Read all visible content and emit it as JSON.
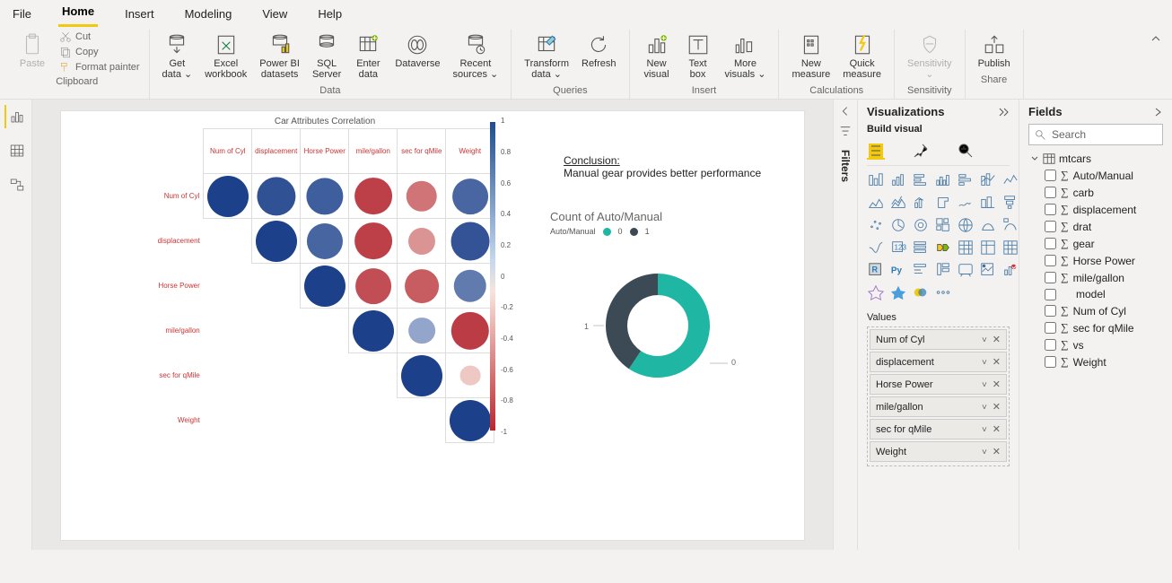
{
  "menu": {
    "items": [
      "File",
      "Home",
      "Insert",
      "Modeling",
      "View",
      "Help"
    ],
    "active": 1
  },
  "ribbon": {
    "groups": [
      {
        "label": "Clipboard"
      },
      {
        "label": "Data"
      },
      {
        "label": "Queries"
      },
      {
        "label": "Insert"
      },
      {
        "label": "Calculations"
      },
      {
        "label": "Sensitivity"
      },
      {
        "label": "Share"
      }
    ],
    "clipboard": {
      "paste": "Paste",
      "cut": "Cut",
      "copy": "Copy",
      "fmt": "Format painter"
    },
    "data": [
      [
        "Get",
        "data ⌄"
      ],
      [
        "Excel",
        "workbook"
      ],
      [
        "Power BI",
        "datasets"
      ],
      [
        "SQL",
        "Server"
      ],
      [
        "Enter",
        "data"
      ],
      [
        "Dataverse",
        ""
      ],
      [
        "Recent",
        "sources ⌄"
      ]
    ],
    "queries": [
      [
        "Transform",
        "data ⌄"
      ],
      [
        "Refresh",
        ""
      ]
    ],
    "insert": [
      [
        "New",
        "visual"
      ],
      [
        "Text",
        "box"
      ],
      [
        "More",
        "visuals ⌄"
      ]
    ],
    "calc": [
      [
        "New",
        "measure"
      ],
      [
        "Quick",
        "measure"
      ]
    ],
    "sens": [
      [
        "Sensitivity",
        "⌄"
      ]
    ],
    "share": [
      [
        "Publish",
        ""
      ]
    ]
  },
  "viz": {
    "title": "Visualizations",
    "sub": "Build visual",
    "values_h": "Values",
    "values": [
      "Num of Cyl",
      "displacement",
      "Horse Power",
      "mile/gallon",
      "sec for qMile",
      "Weight"
    ]
  },
  "filters": {
    "title": "Filters"
  },
  "fields": {
    "title": "Fields",
    "search": "Search",
    "table": "mtcars",
    "cols": [
      {
        "name": "Auto/Manual",
        "sigma": true,
        "checked": false
      },
      {
        "name": "carb",
        "sigma": true,
        "checked": false
      },
      {
        "name": "displacement",
        "sigma": true,
        "checked": false
      },
      {
        "name": "drat",
        "sigma": true,
        "checked": false
      },
      {
        "name": "gear",
        "sigma": true,
        "checked": false
      },
      {
        "name": "Horse Power",
        "sigma": true,
        "checked": false
      },
      {
        "name": "mile/gallon",
        "sigma": true,
        "checked": false
      },
      {
        "name": "model",
        "sigma": false,
        "checked": false
      },
      {
        "name": "Num of Cyl",
        "sigma": true,
        "checked": false
      },
      {
        "name": "sec for qMile",
        "sigma": true,
        "checked": false
      },
      {
        "name": "vs",
        "sigma": true,
        "checked": false
      },
      {
        "name": "Weight",
        "sigma": true,
        "checked": false
      }
    ]
  },
  "report": {
    "conclusion": {
      "head": "Conclusion:",
      "body": "Manual gear provides better performance"
    },
    "donut_title": "Count of Auto/Manual",
    "donut_legend": {
      "label": "Auto/Manual",
      "items": [
        {
          "name": "0",
          "color": "#1fb6a3"
        },
        {
          "name": "1",
          "color": "#3b4a54"
        }
      ]
    }
  },
  "chart_data": [
    {
      "type": "heatmap",
      "title": "Car Attributes Correlation",
      "row_labels": [
        "Num of Cyl",
        "displacement",
        "Horse Power",
        "mile/gallon",
        "sec for qMile",
        "Weight"
      ],
      "col_labels": [
        "Num of Cyl",
        "displacement",
        "Horse Power",
        "mile/gallon",
        "sec for qMile",
        "Weight"
      ],
      "matrix": [
        [
          1.0,
          0.9,
          0.83,
          -0.85,
          -0.59,
          0.78
        ],
        [
          null,
          1.0,
          0.79,
          -0.85,
          -0.43,
          0.89
        ],
        [
          null,
          null,
          1.0,
          -0.78,
          -0.71,
          0.66
        ],
        [
          null,
          null,
          null,
          1.0,
          0.42,
          -0.87
        ],
        [
          null,
          null,
          null,
          null,
          1.0,
          -0.17
        ],
        [
          null,
          null,
          null,
          null,
          null,
          1.0
        ]
      ],
      "colorbar": {
        "min": -1,
        "max": 1,
        "ticks": [
          1,
          0.8,
          0.6,
          0.4,
          0.2,
          0,
          -0.2,
          -0.4,
          -0.6,
          -0.8,
          -1
        ]
      }
    },
    {
      "type": "pie",
      "title": "Count of Auto/Manual",
      "series": [
        {
          "name": "Auto/Manual",
          "values": [
            {
              "category": "0",
              "value": 19,
              "color": "#1fb6a3"
            },
            {
              "category": "1",
              "value": 13,
              "color": "#3b4a54"
            }
          ]
        }
      ],
      "donut": true,
      "axis_markers": [
        "1",
        "0"
      ]
    }
  ]
}
